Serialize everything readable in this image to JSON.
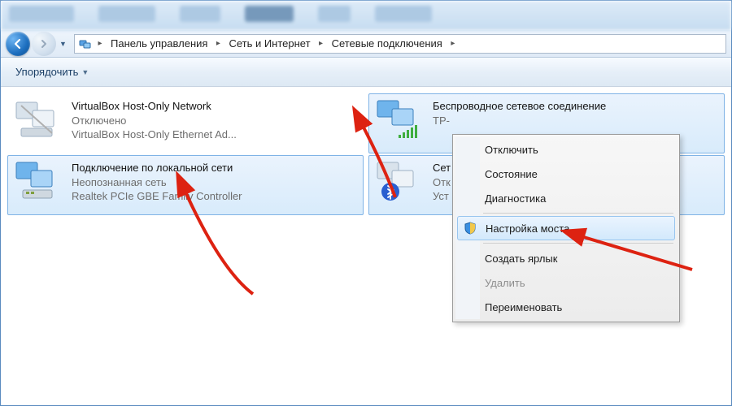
{
  "breadcrumb": {
    "seg1": "Панель управления",
    "seg2": "Сеть и Интернет",
    "seg3": "Сетевые подключения"
  },
  "toolbar": {
    "organize": "Упорядочить"
  },
  "connections": [
    {
      "name": "VirtualBox Host-Only Network",
      "status": "Отключено",
      "device": "VirtualBox Host-Only Ethernet Ad...",
      "icon": "net-disabled"
    },
    {
      "name": "Беспроводное сетевое соединение",
      "status": "",
      "device": "TP-",
      "icon": "net-wifi"
    },
    {
      "name": "Подключение по локальной сети",
      "status": "Неопознанная сеть",
      "device": "Realtek PCIe GBE Family Controller",
      "icon": "net-lan"
    },
    {
      "name": "Сет",
      "status": "Отк",
      "device": "Уст",
      "icon": "net-bt"
    }
  ],
  "context_menu": {
    "items": [
      {
        "label": "Отключить"
      },
      {
        "label": "Состояние"
      },
      {
        "label": "Диагностика"
      },
      {
        "sep": true
      },
      {
        "label": "Настройка моста",
        "icon": "shield",
        "highlight": true
      },
      {
        "sep": true
      },
      {
        "label": "Создать ярлык"
      },
      {
        "label": "Удалить",
        "disabled": true
      },
      {
        "label": "Переименовать"
      }
    ]
  }
}
